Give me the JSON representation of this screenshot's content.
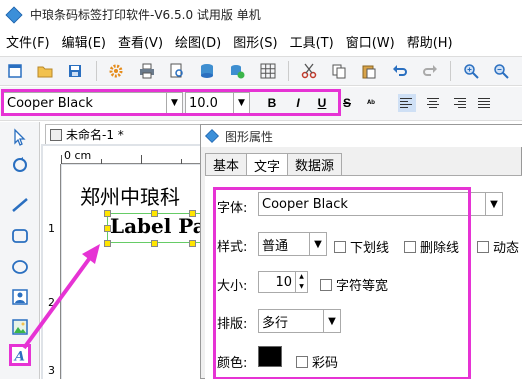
{
  "window": {
    "title": "中琅条码标签打印软件-V6.5.0 试用版 单机"
  },
  "menu": [
    "文件(F)",
    "编辑(E)",
    "查看(V)",
    "绘图(D)",
    "图形(S)",
    "工具(T)",
    "窗口(W)",
    "帮助(H)"
  ],
  "toolbar_icons": [
    "new-file-icon",
    "open-folder-icon",
    "save-icon",
    "settings-icon",
    "print-icon",
    "print-preview-icon",
    "database-icon",
    "database-sync-icon",
    "grid-icon",
    "cut-icon",
    "copy-icon",
    "paste-icon",
    "undo-icon",
    "redo-icon",
    "zoom-in-icon",
    "zoom-out-icon"
  ],
  "fontbar": {
    "font_name": "Cooper Black",
    "font_size": "10.0",
    "bold": "B",
    "italic": "I",
    "underline": "U",
    "strike": "S"
  },
  "document": {
    "tab_title": "未命名-1 *",
    "ruler_top_label": "0 cm",
    "ruler_left_marks": [
      "1",
      "2",
      "3"
    ],
    "canvas_text": "郑州中琅科",
    "label_text": "Label Pa"
  },
  "dialog": {
    "title": "图形属性",
    "tabs": [
      "基本",
      "文字",
      "数据源"
    ],
    "active_tab": "文字",
    "font_label": "字体:",
    "font_value": "Cooper Black",
    "style_label": "样式:",
    "style_value": "普通",
    "underline_label": "下划线",
    "strike_label": "删除线",
    "dynamic_label": "动态",
    "size_label": "大小:",
    "size_value": "10",
    "monospace_label": "字符等宽",
    "layout_label": "排版:",
    "layout_value": "多行",
    "color_label": "颜色:",
    "color_value": "#000000",
    "colorcode_label": "彩码"
  },
  "colors": {
    "highlight": "#e633d4",
    "selection_border": "#66cc66",
    "handle": "#ffe500"
  }
}
